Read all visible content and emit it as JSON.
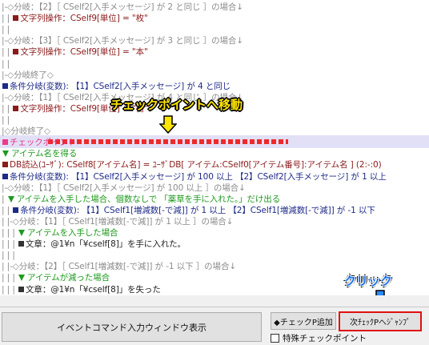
{
  "lines": [
    {
      "prefix": "|-◇分岐：【2】［ CSelf2[入手メッセージ] が 2 と同じ ］の場合↓",
      "cls": "c-gray",
      "mark": ""
    },
    {
      "prefix": "| | ",
      "cls": "c-maroon",
      "mark": "maroon",
      "text": "文字列操作：CSelf9[単位] = \"枚\""
    },
    {
      "prefix": "| | ",
      "cls": "c-gray",
      "mark": "",
      "text": ""
    },
    {
      "prefix": "|-◇分岐：【3】［ CSelf2[入手メッセージ] が 3 と同じ ］の場合↓",
      "cls": "c-gray",
      "mark": ""
    },
    {
      "prefix": "| | ",
      "cls": "c-maroon",
      "mark": "maroon",
      "text": "文字列操作：CSelf9[単位] = \"本\""
    },
    {
      "prefix": "| | ",
      "cls": "c-gray",
      "mark": "",
      "text": ""
    },
    {
      "prefix": "|-◇分岐終了◇",
      "cls": "c-gray",
      "mark": ""
    },
    {
      "prefix": "",
      "cls": "c-navy",
      "mark": "navy",
      "text": "条件分岐(変数): 【1】CSelf2[入手メッセージ] が 4 と同じ"
    },
    {
      "prefix": "|-◇分岐：【1】［ CSelf2[入手メッセージ] が 4 と同じ ］の場合↓",
      "cls": "c-gray",
      "mark": ""
    },
    {
      "prefix": "| | ",
      "cls": "c-maroon",
      "mark": "maroon",
      "text": "文字列操作：CSelf9[単位] = \"冊\""
    },
    {
      "prefix": "| | ",
      "cls": "c-gray",
      "mark": "",
      "text": ""
    },
    {
      "prefix": "|◇分岐終了◇",
      "cls": "c-gray",
      "mark": ""
    },
    {
      "prefix": "",
      "cls": "c-pink",
      "mark": "pink",
      "text": "チェックポイント"
    },
    {
      "prefix": "",
      "cls": "c-green",
      "mark": "tri",
      "text": "アイテム名を得る"
    },
    {
      "prefix": "",
      "cls": "c-maroon",
      "mark": "maroon",
      "text": "DB読込(ﾕｰｻﾞ): CSelf8[アイテム名] = ﾕｰｻﾞDB[ アイテム:CSelf0[アイテム番号]:アイテム名 ] (2:-:0)"
    },
    {
      "prefix": "",
      "cls": "c-navy",
      "mark": "navy",
      "text": "条件分岐(変数): 【1】CSelf2[入手メッセージ] が 100 以上 【2】CSelf2[入手メッセージ] が 1 以上"
    },
    {
      "prefix": "|-◇分岐：【1】［ CSelf2[入手メッセージ] が 100 以上 ］の場合↓",
      "cls": "c-gray",
      "mark": ""
    },
    {
      "prefix": "| ",
      "cls": "c-green",
      "mark": "tri",
      "text": "アイテムを入手した場合、個数なしで 「薬草を手に入れた。」だけ出る"
    },
    {
      "prefix": "| | ",
      "cls": "c-navy",
      "mark": "navy",
      "text": "条件分岐(変数): 【1】CSelf1[増減数[-で減]] が 1 以上 【2】CSelf1[増減数[-で減]] が -1 以下"
    },
    {
      "prefix": "| |-◇分岐：【1】［ CSelf1[増減数[-で減]] が 1 以上 ］の場合↓",
      "cls": "c-gray",
      "mark": ""
    },
    {
      "prefix": "| | | ",
      "cls": "c-green",
      "mark": "tri",
      "text": "アイテムを入手した場合"
    },
    {
      "prefix": "| | | ",
      "cls": "c-black",
      "mark": "black",
      "text": "文章：@1¥n「¥cself[8]」を手に入れた。"
    },
    {
      "prefix": "| | | ",
      "cls": "c-gray",
      "mark": "",
      "text": ""
    },
    {
      "prefix": "| |-◇分岐：【2】［ CSelf1[増減数[-で減]] が -1 以下 ］の場合↓",
      "cls": "c-gray",
      "mark": ""
    },
    {
      "prefix": "| | | ",
      "cls": "c-green",
      "mark": "tri",
      "text": "アイテムが減った場合"
    },
    {
      "prefix": "| | | ",
      "cls": "c-black",
      "mark": "black",
      "text": "文章：@1¥n「¥cself[8]」を失った"
    }
  ],
  "annotations": {
    "move_label": "チェックポイントへ移動",
    "click_label": "クリック"
  },
  "buttons": {
    "event_command": "イベントコマンド入力ウィンドウ表示",
    "add_checkpoint": "◆チェックP追加",
    "next_checkpoint": "次ﾁｪｯｸPへｼﾞｬﾝﾌﾟ",
    "special_checkpoint": "特殊チェックポイント"
  }
}
